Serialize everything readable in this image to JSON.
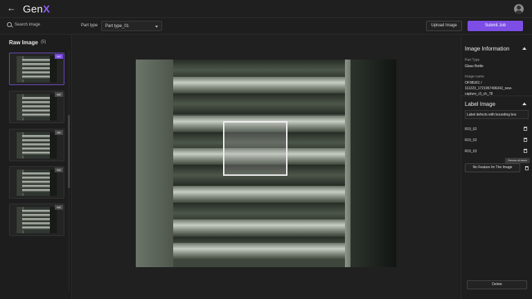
{
  "app": {
    "brand_prefix": "Gen",
    "brand_accent": "X",
    "accent_color": "#7d4ee6"
  },
  "toolbar": {
    "search_placeholder": "Search image",
    "part_type_label": "Part type",
    "part_type_value": "Part type_01",
    "upload_label": "Upload Image",
    "submit_label": "Submit Job"
  },
  "left": {
    "title": "Raw Image",
    "count": "(5)",
    "thumbnails": [
      {
        "tag": "NG"
      },
      {
        "tag": "NG"
      },
      {
        "tag": "OK"
      },
      {
        "tag": "NG"
      },
      {
        "tag": "NG"
      }
    ]
  },
  "right": {
    "info_title": "Image Information",
    "part_type_label": "Part Type",
    "part_type_value": "Glass Bottle",
    "image_name_label": "Image name",
    "image_name_value": "OF98U61 / 111223_1721957496342_new-capture_r3_ch_78",
    "label_title": "Label Image",
    "label_input": "Label defects with bounding box",
    "rois": [
      "ROI_02",
      "ROI_02",
      "ROI_03"
    ],
    "tooltip": "Remove all labels",
    "no_feature_label": "No Feature Iin The Image",
    "delete_label": "Delete"
  },
  "icons": {
    "back": "back-arrow-icon",
    "search": "search-icon",
    "profile": "user-avatar-icon",
    "trash": "trash-icon"
  }
}
